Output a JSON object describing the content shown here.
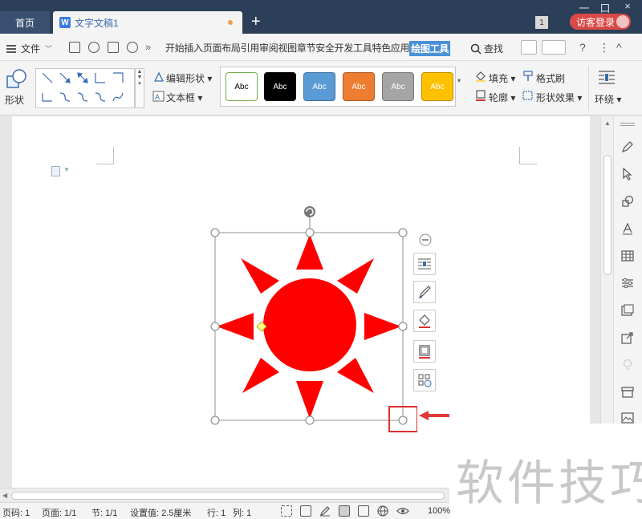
{
  "titlebar": {
    "home_tab": "首页",
    "doc_tab": "文字文稿1",
    "doc_icon_letter": "W",
    "new_tab": "+",
    "window_count": "1",
    "login": "访客登录",
    "window_controls": [
      "一",
      "口",
      "×"
    ]
  },
  "menubar": {
    "file": "文件",
    "more": "»",
    "tabs": [
      "开始",
      "插入",
      "页面布局",
      "引用",
      "审阅",
      "视图",
      "章节",
      "安全",
      "开发工具",
      "特色应用",
      "绘图工具"
    ],
    "active_tab": "绘图工具",
    "search": "查找",
    "help": "?",
    "menu_dots": "⋮",
    "collapse": "^"
  },
  "ribbon": {
    "shape_label": "形状",
    "edit_shape": "编辑形状",
    "text_box": "文本框",
    "style_label": "Abc",
    "styles": [
      {
        "bg": "#ffffff",
        "border": "#70ad47",
        "fg": "#000000"
      },
      {
        "bg": "#000000",
        "border": "#000000",
        "fg": "#ffffff"
      },
      {
        "bg": "#5b9bd5",
        "border": "#41719c",
        "fg": "#ffffff"
      },
      {
        "bg": "#ed7d31",
        "border": "#ae5a21",
        "fg": "#ffffff"
      },
      {
        "bg": "#a5a5a5",
        "border": "#787878",
        "fg": "#ffffff"
      },
      {
        "bg": "#ffc000",
        "border": "#bc8c00",
        "fg": "#ffffff"
      }
    ],
    "fill": "填充",
    "outline": "轮廓",
    "format_painter": "格式刷",
    "shape_effects": "形状效果",
    "wrap": "环绕"
  },
  "shape": {
    "fill_color": "#ff0000",
    "name": "sun"
  },
  "watermark": "软件技巧",
  "statusbar": {
    "page_num": "页码: 1",
    "pages": "页面: 1/1",
    "section": "节: 1/1",
    "setting": "设置值: 2.5厘米",
    "row": "行: 1",
    "col": "列: 1",
    "zoom": "100%"
  }
}
